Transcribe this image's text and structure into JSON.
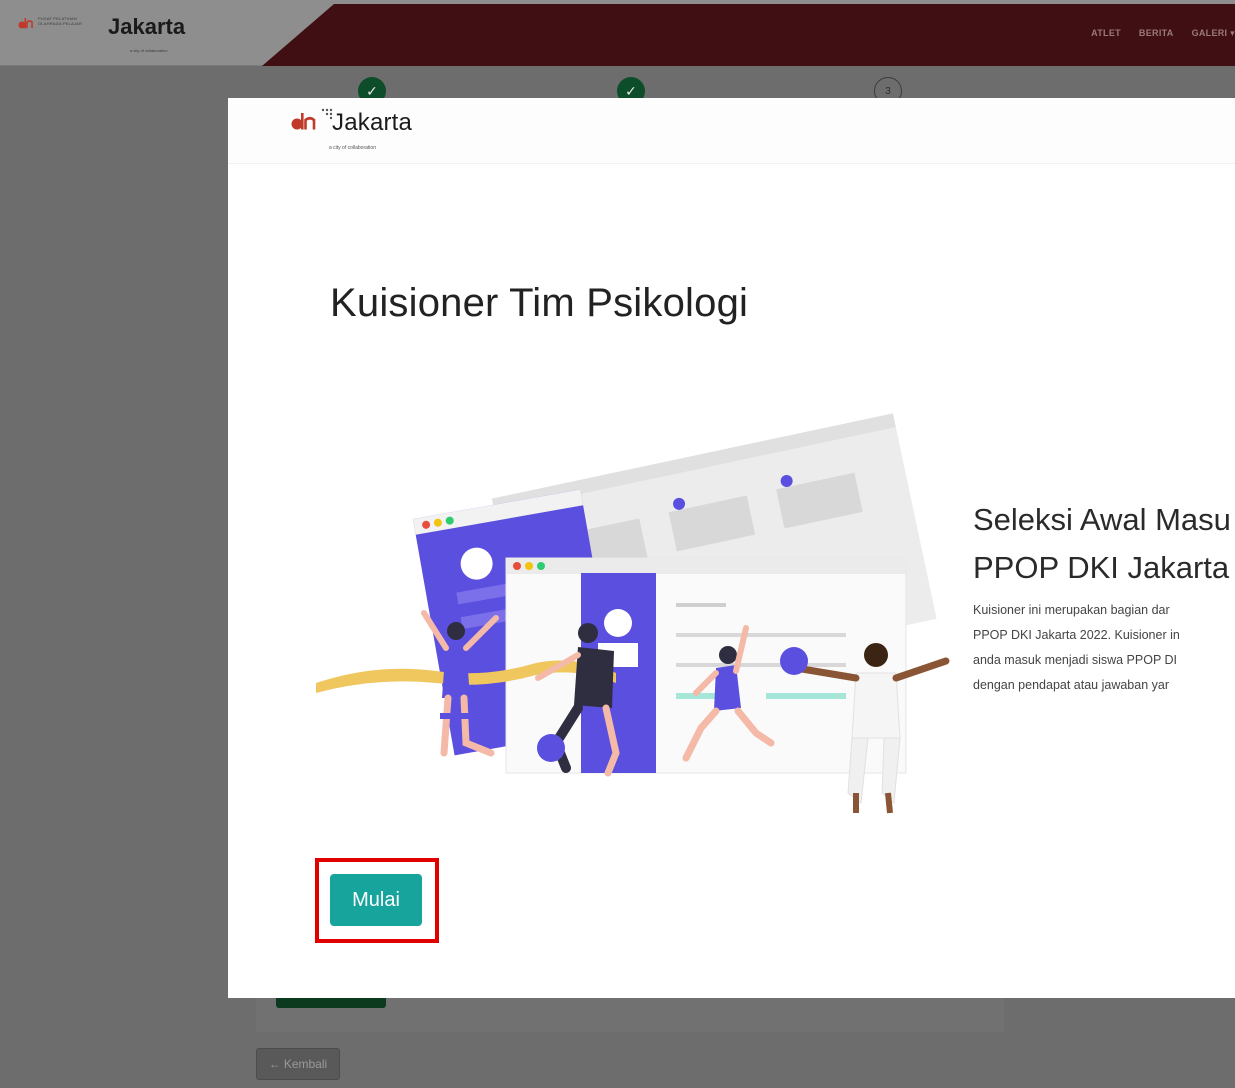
{
  "background": {
    "logo": {
      "org_line1": "PUSAT PELATIHAN",
      "org_line2": "OLAHRAGA PELAJAR",
      "word": "Jakarta",
      "tagline": "a city of collaboration"
    },
    "nav": [
      "ATLET",
      "BERITA",
      "GALERI"
    ],
    "steps": [
      {
        "state": "done",
        "label": "✓"
      },
      {
        "state": "done",
        "label": "✓"
      },
      {
        "state": "todo",
        "label": "3"
      }
    ],
    "back_button": {
      "icon": "arrow-left-icon",
      "label": "Kembali"
    }
  },
  "modal": {
    "logo": {
      "word": "Jakarta",
      "tagline": "a city of collaboration"
    },
    "title": "Kuisioner Tim Psikologi",
    "headline": [
      "Seleksi Awal Masu",
      "PPOP DKI Jakarta"
    ],
    "description": [
      "Kuisioner ini merupakan bagian dar",
      "PPOP DKI Jakarta 2022. Kuisioner in",
      "anda masuk menjadi siswa PPOP DI",
      "dengan pendapat atau jawaban yar"
    ],
    "start_button": "Mulai"
  },
  "colors": {
    "accent_teal": "#17a49c",
    "highlight_red": "#e00000",
    "navbar_maroon": "#3f0f13",
    "step_done_green": "#0d4d2a",
    "illustration_purple": "#5b4fe0"
  }
}
